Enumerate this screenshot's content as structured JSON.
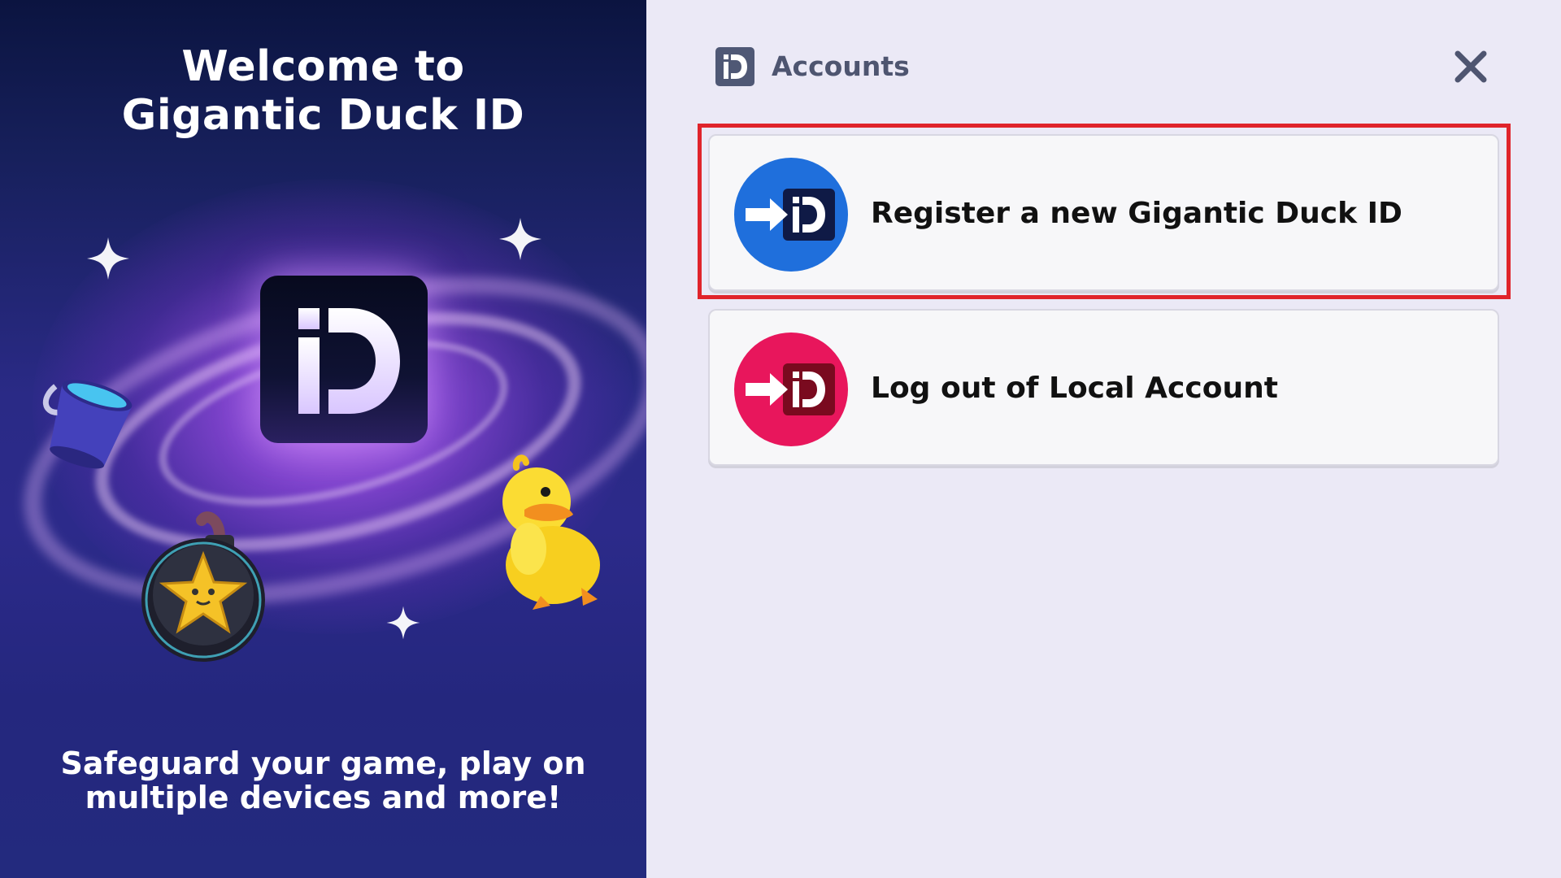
{
  "welcome_panel": {
    "title_line1": "Welcome to",
    "title_line2": "Gigantic Duck ID",
    "tagline_line1": "Safeguard your game, play on",
    "tagline_line2": "multiple devices and more!",
    "logo_icon": "gigantic-duck-id-logo",
    "props": [
      "paint-bucket",
      "bomb-with-star",
      "rubber-duck",
      "sparkles"
    ]
  },
  "header": {
    "title": "Accounts",
    "logo_icon": "id-logo-icon",
    "close_icon": "close-icon"
  },
  "options": [
    {
      "label": "Register a new Gigantic Duck ID",
      "icon": "register-id-icon",
      "color": "#1f6fdc",
      "highlighted": true
    },
    {
      "label": "Log out of Local Account",
      "icon": "logout-id-icon",
      "color": "#e8165c",
      "highlighted": false
    }
  ],
  "colors": {
    "highlight_border": "#e0242b",
    "right_background": "#ebe9f6",
    "left_background": "#232a7e"
  }
}
